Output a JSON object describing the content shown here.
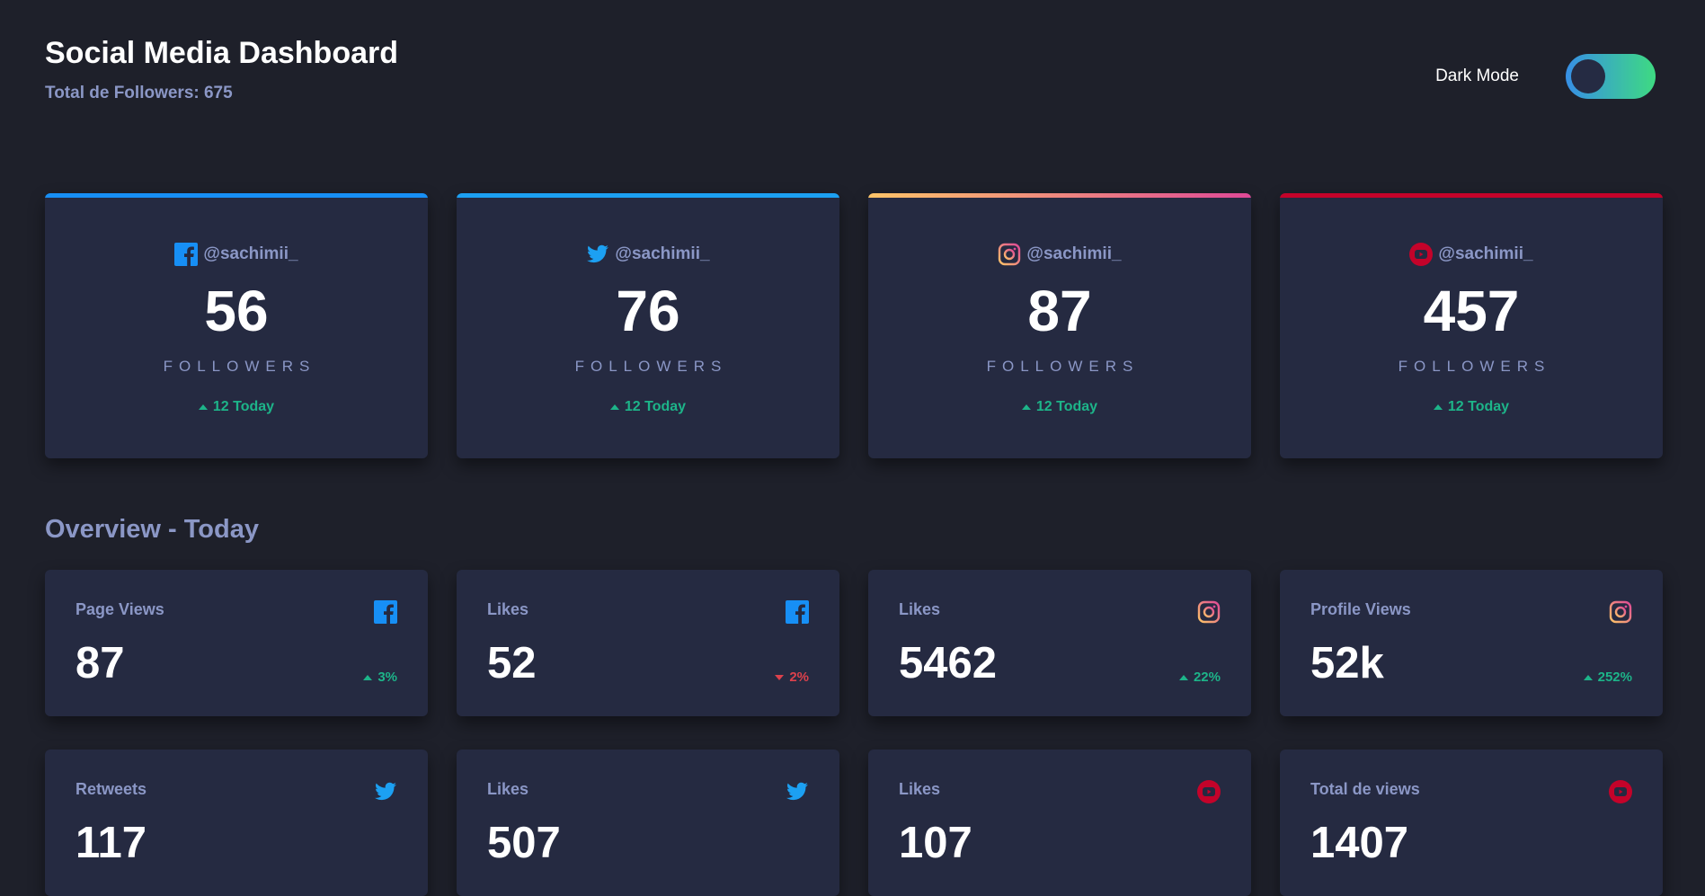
{
  "header": {
    "title": "Social Media Dashboard",
    "subtitle": "Total de Followers: 675",
    "mode_label": "Dark Mode"
  },
  "colors": {
    "background": "#1e202a",
    "card": "#252a41",
    "facebook": "#178ff5",
    "twitter": "#1ca0f2",
    "youtube": "#c4032a",
    "positive": "#1db489",
    "negative": "#dc414c",
    "muted": "#8b97c6"
  },
  "followers": [
    {
      "network": "facebook",
      "icon": "facebook-icon",
      "handle": "@sachimii_",
      "count": "56",
      "label": "FOLLOWERS",
      "today": "12 Today"
    },
    {
      "network": "twitter",
      "icon": "twitter-icon",
      "handle": "@sachimii_",
      "count": "76",
      "label": "FOLLOWERS",
      "today": "12 Today"
    },
    {
      "network": "instagram",
      "icon": "instagram-icon",
      "handle": "@sachimii_",
      "count": "87",
      "label": "FOLLOWERS",
      "today": "12 Today"
    },
    {
      "network": "youtube",
      "icon": "youtube-icon",
      "handle": "@sachimii_",
      "count": "457",
      "label": "FOLLOWERS",
      "today": "12 Today"
    }
  ],
  "overview": {
    "title": "Overview - Today",
    "cards": [
      {
        "label": "Page Views",
        "network": "facebook",
        "icon": "facebook-icon",
        "value": "87",
        "change": "3%",
        "direction": "up"
      },
      {
        "label": "Likes",
        "network": "facebook",
        "icon": "facebook-icon",
        "value": "52",
        "change": "2%",
        "direction": "down"
      },
      {
        "label": "Likes",
        "network": "instagram",
        "icon": "instagram-icon",
        "value": "5462",
        "change": "22%",
        "direction": "up"
      },
      {
        "label": "Profile Views",
        "network": "instagram",
        "icon": "instagram-icon",
        "value": "52k",
        "change": "252%",
        "direction": "up"
      },
      {
        "label": "Retweets",
        "network": "twitter",
        "icon": "twitter-icon",
        "value": "117",
        "change": "",
        "direction": "up"
      },
      {
        "label": "Likes",
        "network": "twitter",
        "icon": "twitter-icon",
        "value": "507",
        "change": "",
        "direction": "up"
      },
      {
        "label": "Likes",
        "network": "youtube",
        "icon": "youtube-icon",
        "value": "107",
        "change": "",
        "direction": "up"
      },
      {
        "label": "Total de views",
        "network": "youtube",
        "icon": "youtube-icon",
        "value": "1407",
        "change": "",
        "direction": "up"
      }
    ]
  }
}
